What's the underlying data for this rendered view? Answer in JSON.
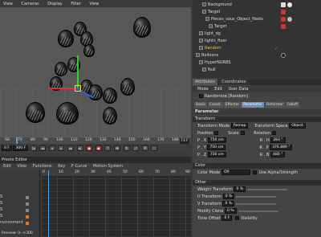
{
  "viewport": {
    "menu": [
      "View",
      "Cameras",
      "Display",
      "Filter",
      "View"
    ]
  },
  "timeline": {
    "ticks": [
      "60",
      "70",
      "80",
      "90",
      "100",
      "110",
      "120",
      "130",
      "140",
      "150",
      "160",
      "170",
      "180"
    ],
    "frame": "73 F",
    "start": "0 F",
    "end": "300 F",
    "current": "0 F"
  },
  "presto": {
    "title": "Presto Editor",
    "menu": [
      "Edit",
      "View",
      "Functions",
      "Key",
      "F-Curve",
      "Motion System"
    ],
    "ruler": [
      "0",
      "10",
      "20",
      "30",
      "40",
      "50",
      "60",
      "70",
      "80",
      "90"
    ],
    "left_items": [
      "S",
      "S",
      "S",
      "S",
      "S",
      "S",
      "nvironment"
    ],
    "status": "Preview: 0-->300"
  },
  "objects": {
    "rows": [
      {
        "label": "Background",
        "indent": 12
      },
      {
        "label": "Target",
        "indent": 12
      },
      {
        "label": "Pieces_sous_Object_fleets",
        "indent": 16
      },
      {
        "label": "Target",
        "indent": 20
      },
      {
        "label": "light_dg",
        "indent": 8
      },
      {
        "label": "lights_floor",
        "indent": 8
      },
      {
        "label": "Random",
        "indent": 8
      },
      {
        "label": "Balloons",
        "indent": 4
      },
      {
        "label": "HyperNURBS",
        "indent": 8
      },
      {
        "label": "Null",
        "indent": 12
      }
    ]
  },
  "attributes": {
    "tabs": [
      "Attributes",
      "Coordinates"
    ],
    "menu": [
      "Mode",
      "Edit",
      "User Data"
    ],
    "object": "Randomize [Random]",
    "subtabs": [
      "Basic",
      "Coord.",
      "Effector",
      "Parameter",
      "Deformer",
      "Falloff"
    ],
    "active_subtab": "Parameter",
    "section_parameter": "Parameter",
    "section_transform": "Transform",
    "transform_mode_label": "Transform Mode",
    "transform_mode_value": "Remap",
    "transform_space_label": "Transform Space",
    "transform_space_value": "Object",
    "position_label": "Position",
    "scale_label": "Scale",
    "rotation_label": "Rotation",
    "px": "750 cm",
    "py": "750 cm",
    "pz": "750 cm",
    "rh": "283 °",
    "rp": "376.889 °",
    "rb": "480 °",
    "section_color": "Color",
    "color_mode_label": "Color Mode",
    "color_mode_value": "Off",
    "use_alpha": "Use Alpha/Strength",
    "section_other": "Other",
    "weight_label": "Weight Transform",
    "weight": "0 %",
    "u_label": "U Transform",
    "u": "0 %",
    "v_label": "V Transform",
    "v": "0 %",
    "modify_label": "Modify Clone",
    "modify": "0 %",
    "time_label": "Time Offset",
    "time": "0 F",
    "visibility": "Visibility"
  }
}
